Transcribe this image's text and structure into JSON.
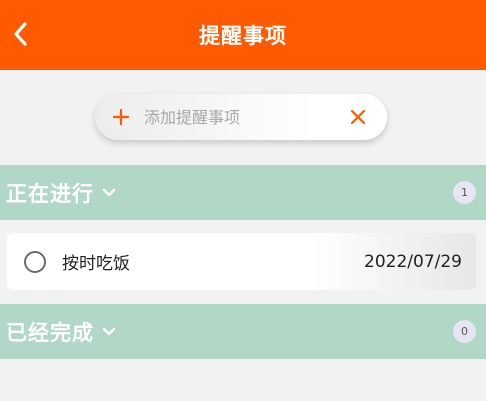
{
  "header": {
    "title": "提醒事项",
    "bg_color": "#ff5a00"
  },
  "add_bar": {
    "placeholder": "添加提醒事项",
    "accent_color": "#ff5a00"
  },
  "sections": [
    {
      "title": "正在进行",
      "count": "1"
    },
    {
      "title": "已经完成",
      "count": "0"
    }
  ],
  "in_progress_tasks": [
    {
      "name": "按时吃饭",
      "date": "2022/07/29"
    }
  ],
  "icons": {
    "back": "chevron-left-icon",
    "add": "plus-icon",
    "clear": "close-icon",
    "expand": "chevron-down-icon"
  },
  "colors": {
    "section_bg": "#b1d8c6",
    "page_bg": "#f2f2f2"
  }
}
